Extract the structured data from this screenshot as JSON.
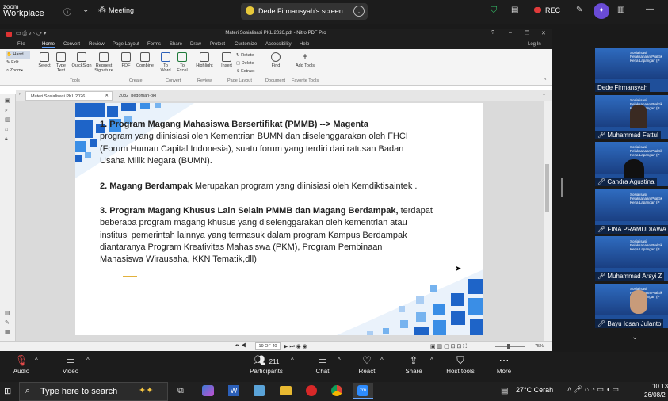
{
  "zoom": {
    "logo_line1": "zoom",
    "logo_line2": "Workplace",
    "meeting_label": "Meeting",
    "screen_label": "Dede Firmansyah's screen",
    "rec_label": "REC"
  },
  "nitro": {
    "title": "Materi Sosialisasi PKL 2026.pdf - Nitro PDF Pro",
    "login": "Log In",
    "menu": [
      "File",
      "Home",
      "Convert",
      "Review",
      "Page Layout",
      "Forms",
      "Share",
      "Draw",
      "Protect",
      "Customize",
      "Accessibility",
      "Help"
    ],
    "left_modes": [
      "Hand",
      "Edit",
      "Zoom"
    ],
    "ribbon_buttons": [
      "Select",
      "Type Text",
      "QuickSign",
      "Request Signature",
      "PDF",
      "Combine",
      "To Word",
      "To Excel",
      "Highlight",
      "Insert",
      "Rotate",
      "Delete",
      "Extract",
      "Find",
      "Add Tools"
    ],
    "ribbon_groups": [
      "Tools",
      "Create",
      "Convert",
      "Review",
      "Page Layout",
      "Document",
      "Favorite Tools"
    ],
    "tabs": [
      "Materi Sosialisasi PKL 2026",
      "2082_pedoman-pkl"
    ],
    "page_indicator": "19 OF 40",
    "zoom_level": "75%"
  },
  "slide": {
    "p1_title": "1. Program Magang Mahasiswa Bersertifikat (PMMB) --> Magenta",
    "p1_l1": "program yang diinisiasi oleh Kementrian BUMN dan diselenggarakan oleh FHCI",
    "p1_l2": "(Forum Human Capital Indonesia), suatu forum yang terdiri dari ratusan Badan",
    "p1_l3": "Usaha Milik Negara (BUMN).",
    "p2_bold": "2. Magang Berdampak",
    "p2_rest": " Merupakan program yang diinisiasi oleh Kemdiktisaintek .",
    "p3_bold": "3. Program Magang Khusus Lain Selain PMMB dan Magang Berdampak,",
    "p3_rest": " terdapat",
    "p3_l2": "beberapa program magang khusus yang diselenggarakan oleh kementrian atau",
    "p3_l3": "institusi pemerintah lainnya yang termasuk dalam program Kampus Berdampak",
    "p3_l4": "diantaranya Program Kreativitas Mahasiswa (PKM), Program Pembinaan",
    "p3_l5": "Mahasiswa Wirausaha, KKN Tematik,dll)"
  },
  "participants": [
    {
      "name": "Dede Firmansyah"
    },
    {
      "name": "Muhammad Fattul"
    },
    {
      "name": "Candra Agustina"
    },
    {
      "name": "FINA PRAMUDIAWA"
    },
    {
      "name": "Muhammad Arsyi Z"
    },
    {
      "name": "Bayu Iqsan Julanto"
    }
  ],
  "thumb_text": "Sosialisasi Pelaksanaan Praktik Kerja Lapangan (P",
  "toolbar": {
    "audio": "Audio",
    "video": "Video",
    "participants": "Participants",
    "participants_count": "211",
    "chat": "Chat",
    "react": "React",
    "share": "Share",
    "host_tools": "Host tools",
    "more": "More"
  },
  "taskbar": {
    "search_placeholder": "Type here to search",
    "weather": "27°C  Cerah",
    "time": "10.13",
    "date": "26/08/2"
  },
  "colors": {
    "accent": "#0b5ed7",
    "zoom_bg": "#1c1c1c"
  }
}
